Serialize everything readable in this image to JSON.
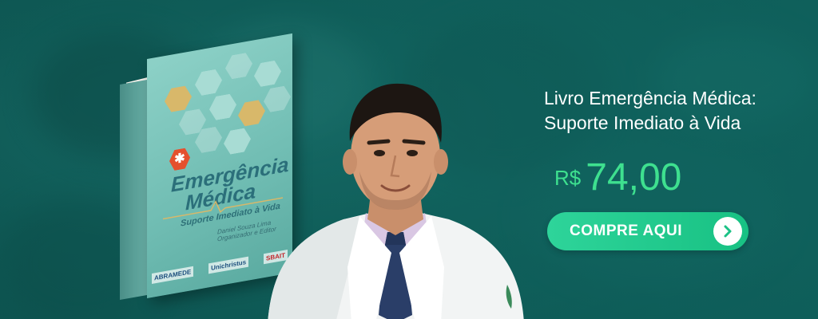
{
  "book": {
    "title_line1": "Emergência",
    "title_line2": "Médica",
    "subtitle": "Suporte Imediato à Vida",
    "author": "Daniel Souza Lima",
    "author_role": "Organizador e Editor",
    "logos": [
      "ABRAMEDE",
      "Unichristus",
      "SBAIT"
    ]
  },
  "product": {
    "title_line1": "Livro Emergência Médica:",
    "title_line2": "Suporte Imediato à Vida"
  },
  "price": {
    "currency": "R$",
    "value": "74,00"
  },
  "cta": {
    "label": "COMPRE AQUI",
    "icon": "chevron-right-icon"
  },
  "colors": {
    "background": "#0f5652",
    "price": "#3ee08f",
    "button": "#1fcb8c"
  }
}
